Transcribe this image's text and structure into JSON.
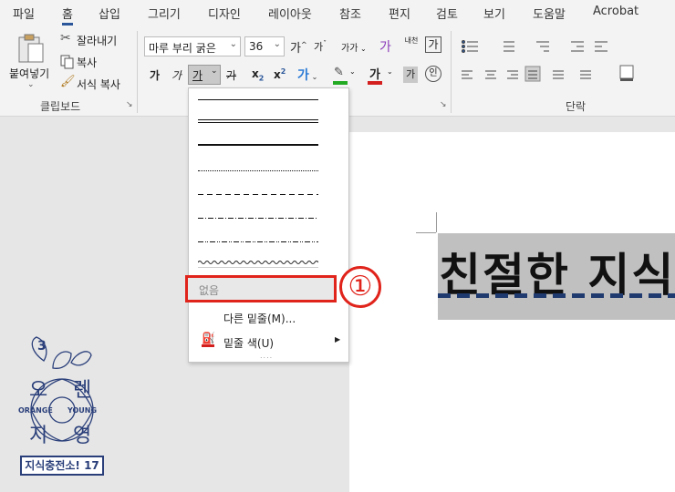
{
  "tabs": [
    "파일",
    "홈",
    "삽입",
    "그리기",
    "디자인",
    "레이아웃",
    "참조",
    "편지",
    "검토",
    "보기",
    "도움말",
    "Acrobat"
  ],
  "clipboard": {
    "paste_label": "붙여넣기",
    "cut_label": "잘라내기",
    "copy_label": "복사",
    "format_painter_label": "서식 복사",
    "group_label": "클립보드"
  },
  "font": {
    "font_name": "마루 부리 굵은",
    "font_size": "36",
    "grow_label": "가",
    "shrink_label": "가",
    "case_label": "가가",
    "clear_label": "가",
    "phonetic_label": "내천",
    "border_char_label": "가",
    "bold_label": "가",
    "italic_label": "가",
    "underline_label": "가",
    "strike_label": "가",
    "subscript_label": "x",
    "superscript_label": "x",
    "effects_label": "가",
    "highlight_label": "가",
    "color_label": "가",
    "shading_label": "가",
    "enclose_label": "인"
  },
  "paragraph": {
    "group_label": "단락"
  },
  "underline_menu": {
    "none_label": "없음",
    "more_label": "다른 밑줄(M)...",
    "color_label": "밑줄 색(U)",
    "more_dots": "....",
    "submenu_arrow": "▶"
  },
  "document": {
    "text": "친절한 지식"
  },
  "annotation": {
    "step": "①"
  },
  "logo": {
    "number": "3",
    "line1_left": "오",
    "line1_right": "렌",
    "line2_left": "ORANGE",
    "line2_right": "YOUNG",
    "line3_left": "지",
    "line3_right": "영",
    "badge": "지식충전소! 17"
  },
  "colors": {
    "accent": "#2b579a",
    "annotation_red": "#e0231b",
    "underline_dash": "#1f3a6e",
    "highlight_green": "#22aa22",
    "font_color_red": "#d41f1f",
    "logo_blue": "#2a3f7a"
  }
}
